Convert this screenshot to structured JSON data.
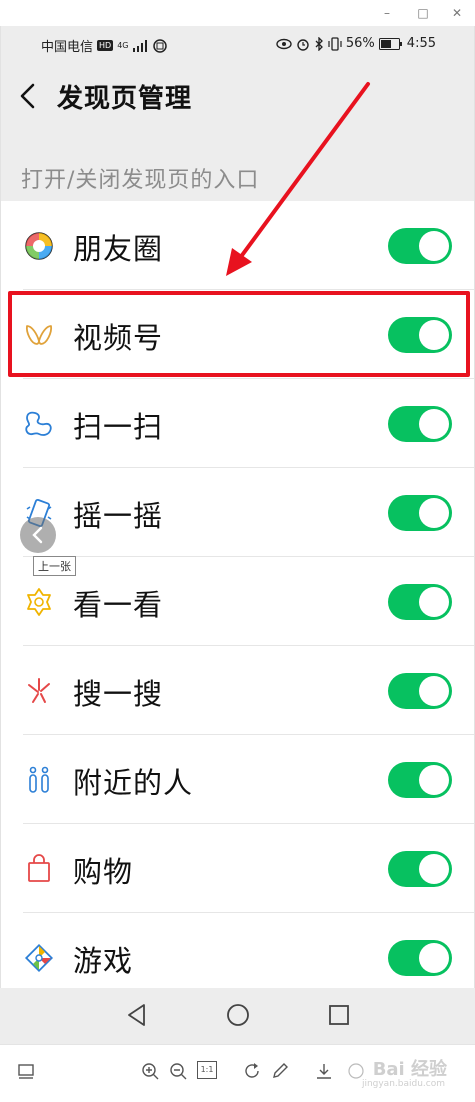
{
  "viewer": {
    "minimize_glyph": "–",
    "maximize_glyph": "□",
    "close_glyph": "✕"
  },
  "status_bar": {
    "carrier": "中国电信",
    "hd": "HD",
    "network": "4G",
    "battery": "56%",
    "time": "4:55"
  },
  "nav": {
    "title": "发现页管理"
  },
  "section": {
    "label": "打开/关闭发现页的入口"
  },
  "items": [
    {
      "label": "朋友圈",
      "icon": "moments-icon",
      "enabled": true
    },
    {
      "label": "视频号",
      "icon": "channels-icon",
      "enabled": true
    },
    {
      "label": "扫一扫",
      "icon": "scan-icon",
      "enabled": true
    },
    {
      "label": "摇一摇",
      "icon": "shake-icon",
      "enabled": true
    },
    {
      "label": "看一看",
      "icon": "top-stories-icon",
      "enabled": true
    },
    {
      "label": "搜一搜",
      "icon": "search-icon",
      "enabled": true
    },
    {
      "label": "附近的人",
      "icon": "people-nearby-icon",
      "enabled": true
    },
    {
      "label": "购物",
      "icon": "shopping-bag-icon",
      "enabled": true
    },
    {
      "label": "游戏",
      "icon": "games-icon",
      "enabled": true
    }
  ],
  "overlay": {
    "prev_tooltip": "上一张"
  },
  "toolbar": {
    "zoom_actual": "1:1",
    "watermark": "Bai 经验",
    "watermark_sub": "jingyan.baidu.com"
  },
  "colors": {
    "toggle_on": "#07c160",
    "highlight": "#e8121f",
    "background": "#ededed"
  }
}
